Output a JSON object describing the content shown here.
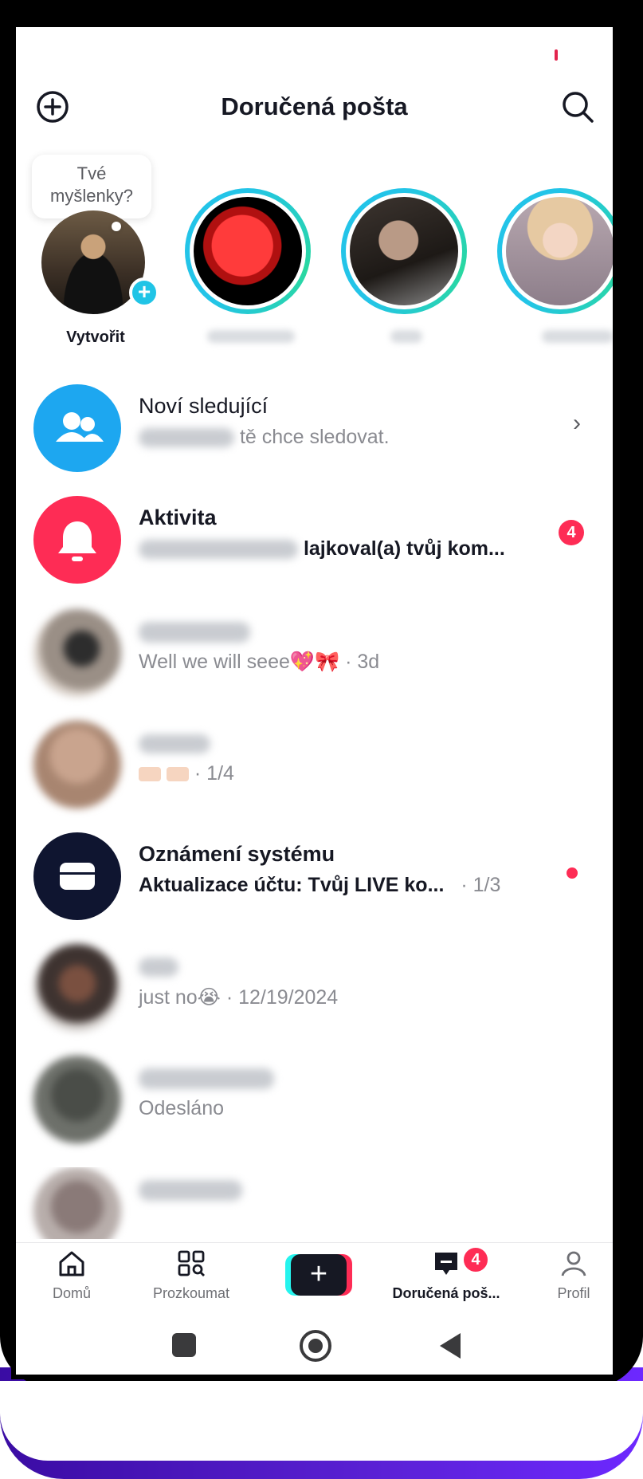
{
  "header": {
    "title": "Doručená pošta",
    "add_icon": "plus-circle-icon",
    "search_icon": "search-icon"
  },
  "stories": {
    "bubble_text_line1": "Tvé",
    "bubble_text_line2": "myšlenky?",
    "create_label": "Vytvořit"
  },
  "rows": [
    {
      "kind": "new-followers",
      "title": "Noví sledující",
      "subtitle": "tě chce sledovat."
    },
    {
      "kind": "activity",
      "title": "Aktivita",
      "subtitle": "lajkoval(a) tvůj kom...",
      "badge": "4"
    },
    {
      "kind": "chat",
      "subtitle": "Well we will seee💖🎀 · 3d"
    },
    {
      "kind": "chat",
      "subtitle": "· 1/4"
    },
    {
      "kind": "system",
      "title": "Oznámení systému",
      "subtitle": "Aktualizace účtu: Tvůj LIVE ko...",
      "time": "· 1/3"
    },
    {
      "kind": "chat",
      "subtitle": "just no😭 · 12/19/2024"
    },
    {
      "kind": "chat",
      "subtitle": "Odesláno"
    }
  ],
  "nav": {
    "home": "Domů",
    "explore": "Prozkoumat",
    "inbox": "Doručená poš...",
    "inbox_badge": "4",
    "profile": "Profil"
  },
  "colors": {
    "accent_red": "#fe2c55",
    "accent_cyan": "#25f4ee",
    "story_ring": "#23c4e8",
    "followers_icon_bg": "#1da7f0",
    "activity_icon_bg": "#fe2c55",
    "system_icon_bg": "#0f1530"
  }
}
